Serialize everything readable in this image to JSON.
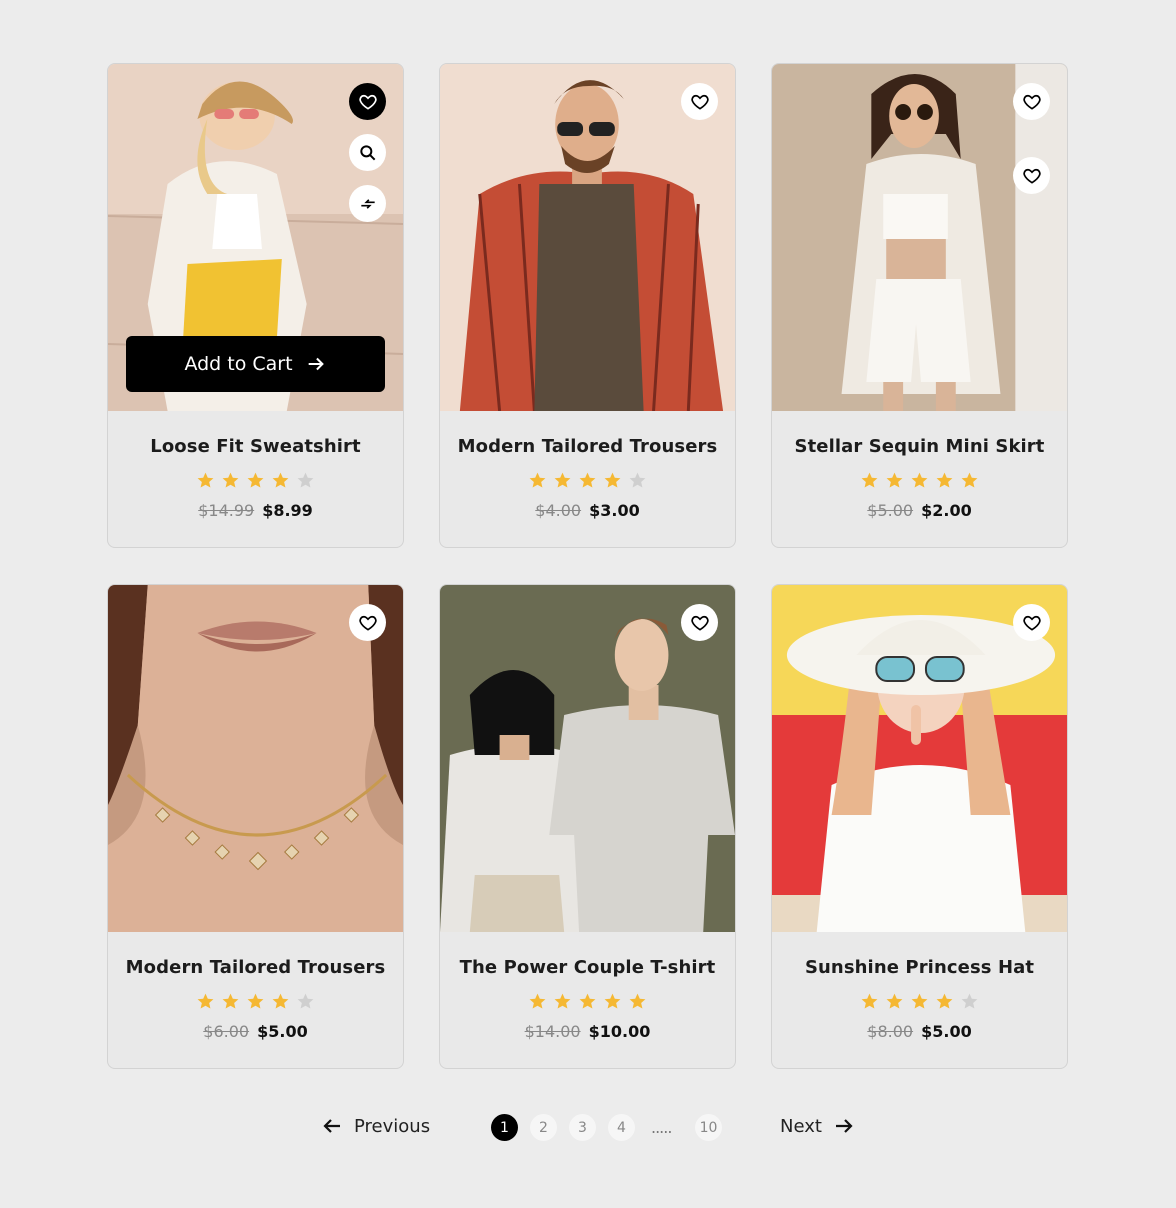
{
  "products": [
    {
      "title": "Loose Fit Sweatshirt",
      "rating": 4,
      "old_price": "$14.99",
      "price": "$8.99"
    },
    {
      "title": "Modern Tailored Trousers",
      "rating": 4,
      "old_price": "$4.00",
      "price": "$3.00"
    },
    {
      "title": "Stellar Sequin Mini Skirt",
      "rating": 5,
      "old_price": "$5.00",
      "price": "$2.00"
    },
    {
      "title": "Modern Tailored Trousers",
      "rating": 4,
      "old_price": "$6.00",
      "price": "$5.00"
    },
    {
      "title": "The Power Couple T-shirt",
      "rating": 5,
      "old_price": "$14.00",
      "price": "$10.00"
    },
    {
      "title": "Sunshine Princess Hat",
      "rating": 4,
      "old_price": "$8.00",
      "price": "$5.00"
    }
  ],
  "card_actions": {
    "add_to_cart_label": "Add to Cart",
    "wishlist_icon": "heart-icon",
    "quick_view_icon": "search-icon",
    "compare_icon": "compare-arrows-icon"
  },
  "pagination": {
    "previous_label": "Previous",
    "next_label": "Next",
    "pages": [
      "1",
      "2",
      "3",
      "4",
      "10"
    ],
    "ellipsis": ".....",
    "current_page": "1"
  },
  "colors": {
    "background": "#ececec",
    "card": "#e9e9e9",
    "star_filled": "#f5b833",
    "star_empty": "#cfcfcf",
    "primary_button": "#000000"
  }
}
